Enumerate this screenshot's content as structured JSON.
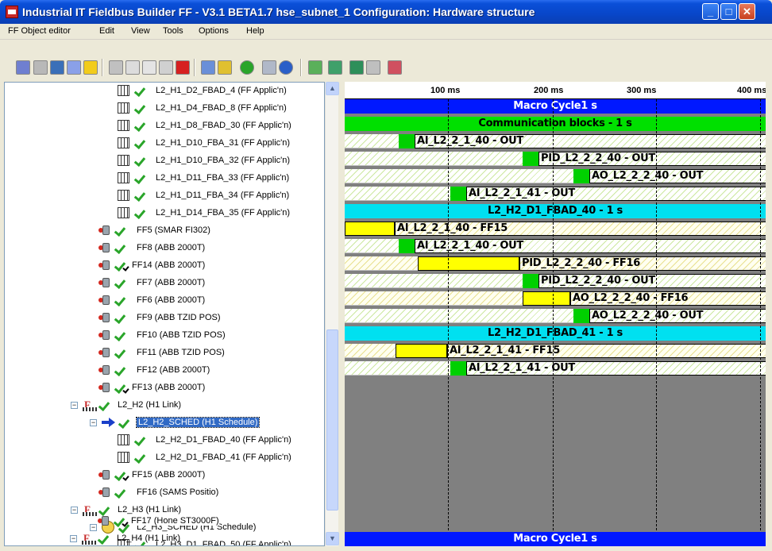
{
  "window": {
    "title": "Industrial IT Fieldbus Builder FF - V3.1 BETA1.7 hse_subnet_1  Configuration: Hardware structure",
    "minimize": "_",
    "maximize": "□",
    "close": "✕"
  },
  "menu": [
    "FF Object editor",
    "Edit",
    "View",
    "Tools",
    "Options",
    "Help"
  ],
  "toolbar_icons": [
    "app-structure-icon",
    "disabled-icon",
    "save-icon",
    "check-icon",
    "warning-icon",
    "undo-icon",
    "cut-icon",
    "copy-icon",
    "paste-icon",
    "delete-icon",
    "table-icon",
    "grid-icon",
    "go-icon",
    "user-icon",
    "help-icon",
    "add-block-icon",
    "refresh-icon",
    "download-icon",
    "upload-icon",
    "cancel-icon"
  ],
  "tree": {
    "nodes": [
      {
        "label": "L2_H1_D2_FBAD_4 (FF Applic'n)"
      },
      {
        "label": "L2_H1_D4_FBAD_8 (FF Applic'n)"
      },
      {
        "label": "L2_H1_D8_FBAD_30 (FF Applic'n)"
      },
      {
        "label": "L2_H1_D10_FBA_31 (FF Applic'n)"
      },
      {
        "label": "L2_H1_D10_FBA_32 (FF Applic'n)"
      },
      {
        "label": "L2_H1_D11_FBA_33 (FF Applic'n)"
      },
      {
        "label": "L2_H1_D11_FBA_34 (FF Applic'n)"
      },
      {
        "label": "L2_H1_D14_FBA_35 (FF Applic'n)"
      },
      {
        "label": "FF5 (SMAR FI302)"
      },
      {
        "label": "FF8 (ABB 2000T)"
      },
      {
        "label": "FF14 (ABB 2000T)"
      },
      {
        "label": "FF7 (ABB 2000T)"
      },
      {
        "label": "FF6 (ABB 2000T)"
      },
      {
        "label": "FF9 (ABB TZID POS)"
      },
      {
        "label": "FF10 (ABB TZID POS)"
      },
      {
        "label": "FF11 (ABB TZID POS)"
      },
      {
        "label": "FF12 (ABB 2000T)"
      },
      {
        "label": "FF13 (ABB 2000T)"
      },
      {
        "label": "L2_H2 (H1 Link)"
      },
      {
        "label": "L2_H2_SCHED (H1 Schedule)"
      },
      {
        "label": "L2_H2_D1_FBAD_40 (FF Applic'n)"
      },
      {
        "label": "L2_H2_D1_FBAD_41 (FF Applic'n)"
      },
      {
        "label": "FF15 (ABB 2000T)"
      },
      {
        "label": "FF16 (SAMS Positio)"
      },
      {
        "label": "L2_H3 (H1 Link)"
      },
      {
        "label": "L2_H3_SCHED (H1 Schedule)"
      },
      {
        "label": "L2_H3_D1_FBAD_50 (FF Applic'n)"
      },
      {
        "label": "FF17 (Hone ST3000F)"
      },
      {
        "label": "L2_H4 (H1 Link)"
      }
    ],
    "expand_minus": "−",
    "scroll_up": "▲",
    "scroll_down": "▼"
  },
  "schedule": {
    "ruler": [
      "100 ms",
      "200 ms",
      "300 ms",
      "400 ms"
    ],
    "macro_cycle": "Macro Cycle1 s",
    "comm_blocks": "Communication blocks - 1 s",
    "fbad40": "L2_H2_D1_FBAD_40 - 1 s",
    "fbad41": "L2_H2_D1_FBAD_41 - 1 s",
    "rows": [
      "AI_L2_2_1_40 - OUT",
      "PID_L2_2_2_40 - OUT",
      "AO_L2_2_2_40 - OUT",
      "AI_L2_2_1_41 - OUT",
      "AI_L2_2_1_40 - FF15",
      "AI_L2_2_1_40 - OUT",
      "PID_L2_2_2_40 - FF16",
      "PID_L2_2_2_40 - OUT",
      "AO_L2_2_2_40 - FF16",
      "AO_L2_2_2_40 - OUT",
      "AI_L2_2_1_41 - FF15",
      "AI_L2_2_1_41 - OUT"
    ]
  }
}
